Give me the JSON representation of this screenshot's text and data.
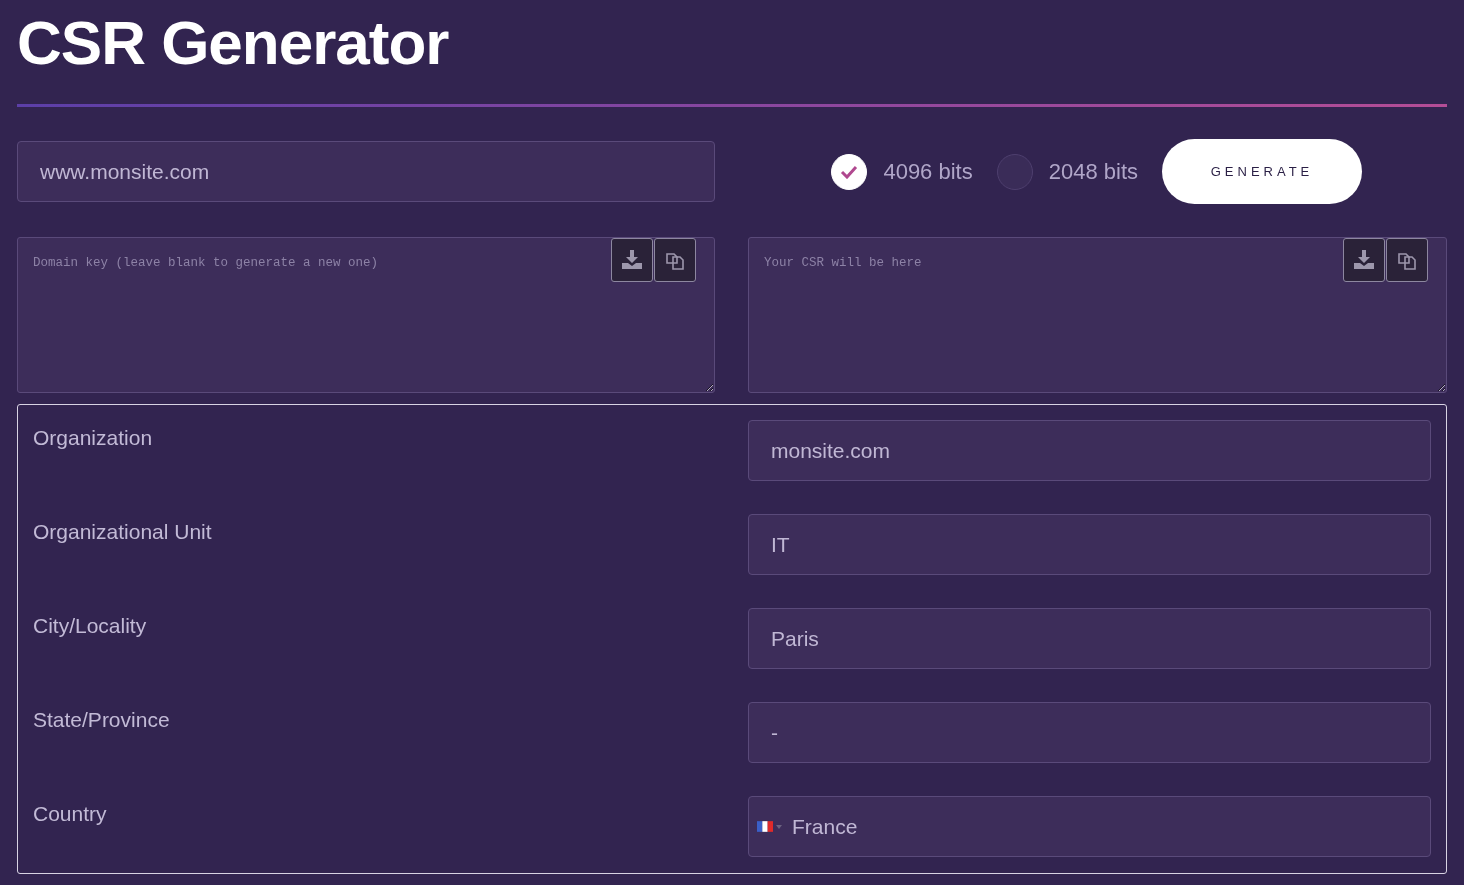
{
  "title": "CSR Generator",
  "domain": {
    "value": "www.monsite.com"
  },
  "key_sizes": [
    {
      "label": "4096 bits",
      "selected": true
    },
    {
      "label": "2048 bits",
      "selected": false
    }
  ],
  "generate_button": "GENERATE",
  "key_box": {
    "placeholder": "Domain key (leave blank to generate a new one)"
  },
  "csr_box": {
    "placeholder": "Your CSR will be here"
  },
  "fields": [
    {
      "label": "Organization",
      "value": "monsite.com",
      "kind": "text"
    },
    {
      "label": "Organizational Unit",
      "value": "IT",
      "kind": "text"
    },
    {
      "label": "City/Locality",
      "value": "Paris",
      "kind": "text"
    },
    {
      "label": "State/Province",
      "value": "-",
      "kind": "text"
    },
    {
      "label": "Country",
      "value": "France",
      "kind": "country"
    }
  ]
}
